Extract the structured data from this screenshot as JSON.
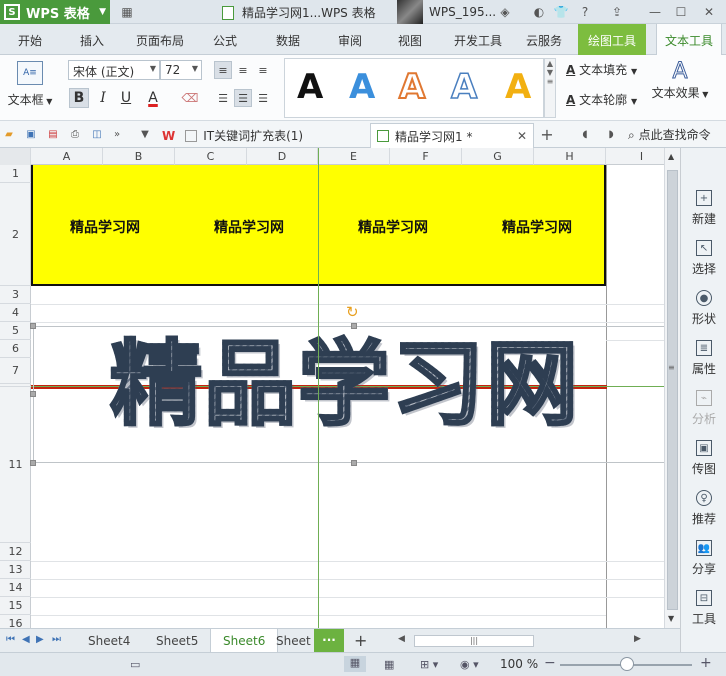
{
  "titlebar": {
    "app_name": "WPS 表格",
    "doc_title": "精品学习网1...WPS 表格",
    "user_name": "WPS_195..."
  },
  "menu": {
    "tabs": [
      "开始",
      "插入",
      "页面布局",
      "公式",
      "数据",
      "审阅",
      "视图",
      "开发工具",
      "云服务"
    ],
    "draw_tools": "绘图工具",
    "text_tools": "文本工具"
  },
  "ribbon": {
    "textbox_label": "文本框",
    "font_name": "宋体 (正文)",
    "font_size": "72",
    "bold": "B",
    "italic": "I",
    "underline": "U",
    "font_color": "A",
    "style_letter": "A",
    "text_fill": "文本填充",
    "text_outline": "文本轮廓",
    "text_effect": "文本效果"
  },
  "quickbar": {
    "doc_tab_1": "IT关键词扩充表(1)",
    "doc_tab_2": "精品学习网1 *",
    "search_label": "点此查找命令"
  },
  "sheet": {
    "columns": [
      "A",
      "B",
      "C",
      "D",
      "E",
      "F",
      "G",
      "H",
      "I"
    ],
    "rows": [
      "1",
      "2",
      "3",
      "4",
      "5",
      "6",
      "7",
      "11",
      "12",
      "13",
      "14",
      "15",
      "16"
    ],
    "row_hidden_label": "11",
    "header_cells": [
      "精品学习网",
      "精品学习网",
      "精品学习网",
      "精品学习网"
    ],
    "wordart_text": "精品学习网"
  },
  "sidepanel": {
    "items": [
      "新建",
      "选择",
      "形状",
      "属性",
      "分析",
      "传图",
      "推荐",
      "分享",
      "工具"
    ]
  },
  "sheettabs": {
    "tabs": [
      "Sheet4",
      "Sheet5",
      "Sheet6",
      "Sheet"
    ],
    "active": "Sheet6",
    "more": "···",
    "add": "+"
  },
  "status": {
    "zoom": "100 %"
  },
  "colors": {
    "brand_green": "#4a9a3c",
    "highlight_yellow": "#ffff00",
    "red_rule": "#c4220f"
  }
}
